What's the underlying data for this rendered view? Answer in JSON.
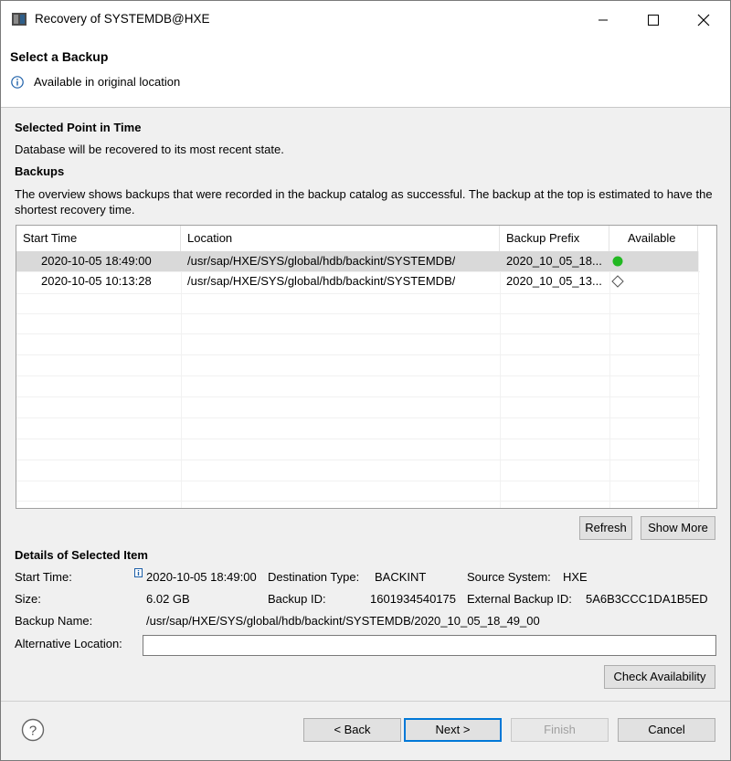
{
  "window": {
    "title": "Recovery of SYSTEMDB@HXE"
  },
  "banner": {
    "title": "Select a Backup",
    "message": "Available in original location"
  },
  "point_in_time": {
    "heading": "Selected Point in Time",
    "text": "Database will be recovered to its most recent state."
  },
  "backups": {
    "heading": "Backups",
    "description": "The overview shows backups that were recorded in the backup catalog as successful. The backup at the top is estimated to have the shortest recovery time.",
    "columns": [
      "Start Time",
      "Location",
      "Backup Prefix",
      "Available"
    ],
    "rows": [
      {
        "start_time": "2020-10-05 18:49:00",
        "location": "/usr/sap/HXE/SYS/global/hdb/backint/SYSTEMDB/",
        "prefix": "2020_10_05_18...",
        "available_icon": "green-dot-icon",
        "selected": true
      },
      {
        "start_time": "2020-10-05 10:13:28",
        "location": "/usr/sap/HXE/SYS/global/hdb/backint/SYSTEMDB/",
        "prefix": "2020_10_05_13...",
        "available_icon": "diamond-outline-icon",
        "selected": false
      }
    ],
    "refresh_label": "Refresh",
    "show_more_label": "Show More"
  },
  "details": {
    "heading": "Details of Selected Item",
    "start_time_label": "Start Time:",
    "start_time_value": "2020-10-05 18:49:00",
    "size_label": "Size:",
    "size_value": "6.02 GB",
    "destination_type_label": "Destination Type:",
    "destination_type_value": "BACKINT",
    "backup_id_label": "Backup ID:",
    "backup_id_value": "1601934540175",
    "source_system_label": "Source System:",
    "source_system_value": "HXE",
    "external_backup_id_label": "External Backup ID:",
    "external_backup_id_value": "5A6B3CCC1DA1B5ED",
    "backup_name_label": "Backup Name:",
    "backup_name_value": "/usr/sap/HXE/SYS/global/hdb/backint/SYSTEMDB/2020_10_05_18_49_00",
    "alternative_location_label": "Alternative Location:",
    "alternative_location_value": "",
    "check_availability_label": "Check Availability"
  },
  "footer": {
    "back_label": "< Back",
    "next_label": "Next >",
    "finish_label": "Finish",
    "cancel_label": "Cancel"
  },
  "colors": {
    "available_green": "#22b822",
    "selection_gray": "#d9d9d9",
    "primary_border": "#0078d7"
  }
}
